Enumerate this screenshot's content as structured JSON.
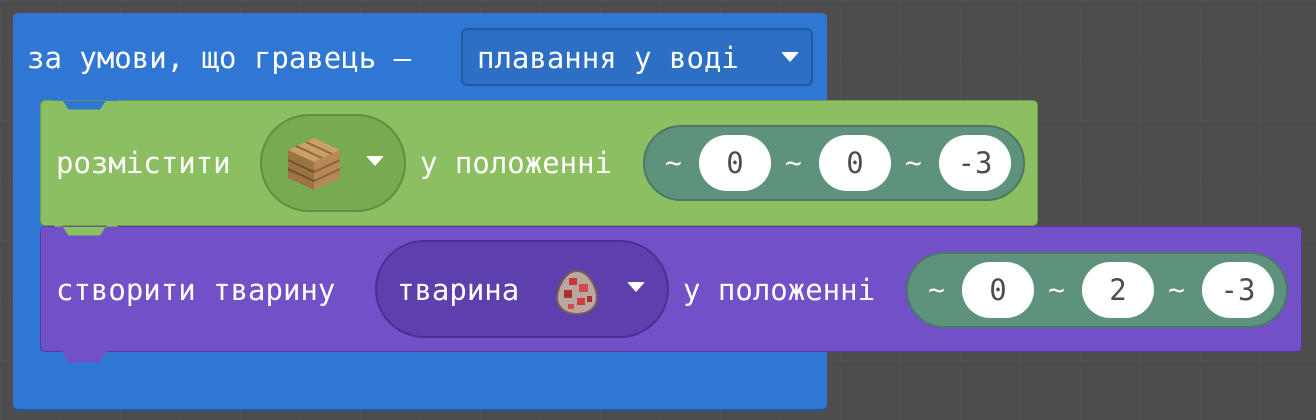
{
  "event_block": {
    "label": "за умови, що гравець —",
    "condition_value": "плавання у воді",
    "color": "#2f77d2"
  },
  "place_block": {
    "label": "розмістити",
    "block_icon": "oak-planks-icon",
    "at_label": "у положенні",
    "position": {
      "x": "0",
      "y": "0",
      "z": "-3"
    },
    "tilde": "~",
    "color": "#8bbf62"
  },
  "spawn_block": {
    "label": "створити тварину",
    "animal_value": "тварина",
    "animal_icon": "spawn-egg-icon",
    "at_label": "у положенні",
    "position": {
      "x": "0",
      "y": "2",
      "z": "-3"
    },
    "tilde": "~",
    "color": "#7150c8"
  }
}
